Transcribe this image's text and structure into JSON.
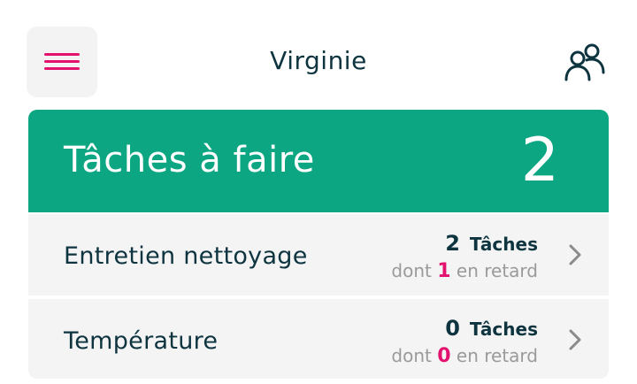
{
  "header": {
    "menu_icon": "hamburger-menu-icon",
    "user_name": "Virginie",
    "users_icon": "users-group-icon"
  },
  "card": {
    "title": "Tâches à faire",
    "count": "2",
    "header_color": "#0da682",
    "rows": [
      {
        "label": "Entretien nettoyage",
        "task_count": "2",
        "task_word": "Tâches",
        "dont": "dont",
        "late_count": "1",
        "late_text": "en retard"
      },
      {
        "label": "Température",
        "task_count": "0",
        "task_word": "Tâches",
        "dont": "dont",
        "late_count": "0",
        "late_text": "en retard"
      }
    ]
  },
  "colors": {
    "accent_pink": "#e3126f",
    "primary_green": "#0da682",
    "text_dark": "#0e3440"
  }
}
